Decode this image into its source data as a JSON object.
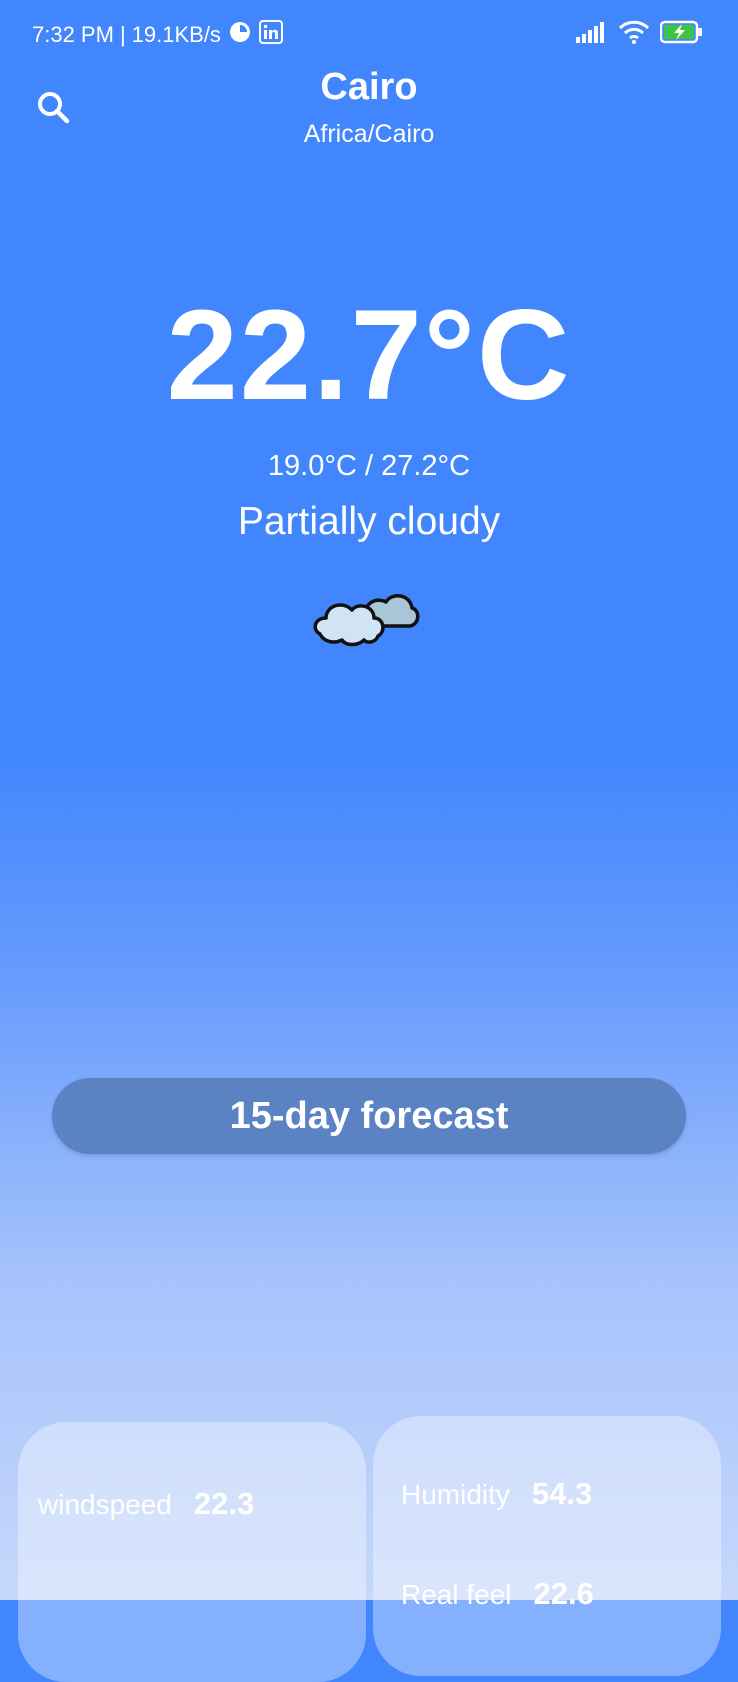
{
  "status_bar": {
    "time": "7:32 PM",
    "separator": "|",
    "net_speed": "19.1KB/s",
    "icons": [
      "clock-app-icon",
      "linkedin-icon",
      "signal-icon",
      "wifi-icon",
      "battery-charging-icon"
    ]
  },
  "header": {
    "search_icon": "search-icon",
    "city": "Cairo",
    "timezone": "Africa/Cairo"
  },
  "weather": {
    "temperature": "22.7°C",
    "range": "19.0°C / 27.2°C",
    "condition": "Partially cloudy",
    "condition_icon": "partly-cloudy-icon"
  },
  "forecast_button": {
    "label": "15-day forecast"
  },
  "details": {
    "windspeed_label": "windspeed",
    "windspeed_value": "22.3",
    "humidity_label": "Humidity",
    "humidity_value": "54.3",
    "realfeel_label": "Real feel",
    "realfeel_value": "22.6"
  },
  "colors": {
    "sky_top": "#4286fd",
    "sky_bottom": "#c6d8fb",
    "button_bg": "#5b83c3",
    "battery_green": "#3ec43e"
  }
}
